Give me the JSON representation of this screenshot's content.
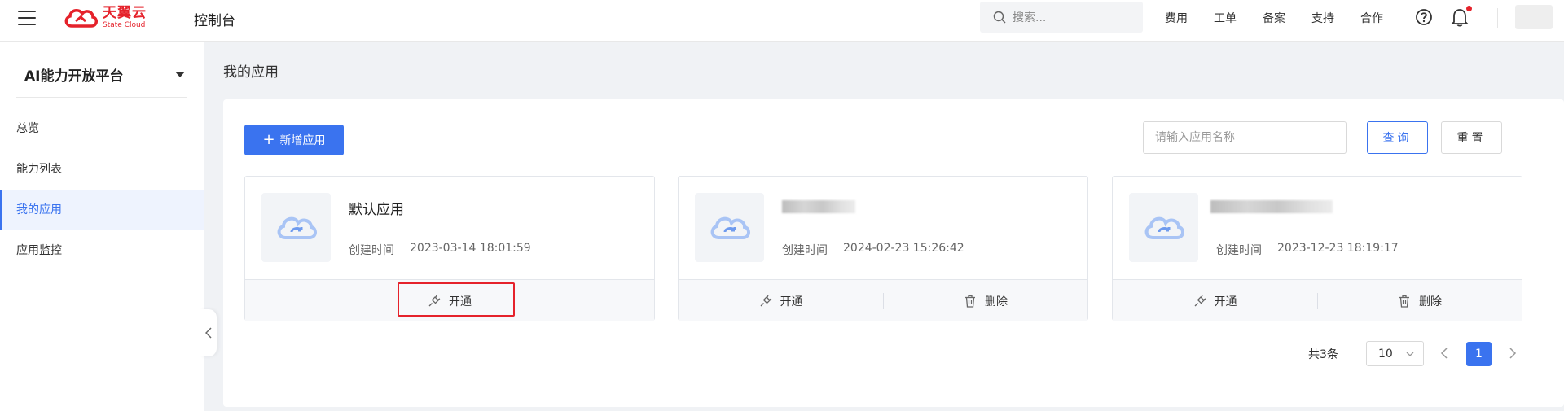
{
  "header": {
    "logo_cn": "天翼云",
    "logo_en": "State Cloud",
    "console_title": "控制台",
    "search_placeholder": "搜索...",
    "nav_links": [
      "费用",
      "工单",
      "备案",
      "支持",
      "合作"
    ],
    "accent_color": "#e5222b"
  },
  "sidebar": {
    "platform": "AI能力开放平台",
    "items": [
      {
        "label": "总览",
        "active": false
      },
      {
        "label": "能力列表",
        "active": false
      },
      {
        "label": "我的应用",
        "active": true
      },
      {
        "label": "应用监控",
        "active": false
      }
    ]
  },
  "main": {
    "page_title": "我的应用",
    "add_button": "新增应用",
    "name_input_placeholder": "请输入应用名称",
    "query_button": "查询",
    "reset_button": "重置",
    "primary_color": "#3a73ef",
    "cards": [
      {
        "name": "默认应用",
        "name_blurred": false,
        "created_label": "创建时间",
        "created_at": "2023-03-14 18:01:59",
        "open_label": "开通",
        "delete_label": ""
      },
      {
        "name": "",
        "name_blurred": true,
        "created_label": "创建时间",
        "created_at": "2024-02-23 15:26:42",
        "open_label": "开通",
        "delete_label": "删除"
      },
      {
        "name": "",
        "name_blurred": true,
        "created_label": "创建时间",
        "created_at": "2023-12-23 18:19:17",
        "open_label": "开通",
        "delete_label": "删除"
      }
    ],
    "pagination": {
      "total": "共3条",
      "page_size": "10",
      "current_page": "1"
    }
  }
}
